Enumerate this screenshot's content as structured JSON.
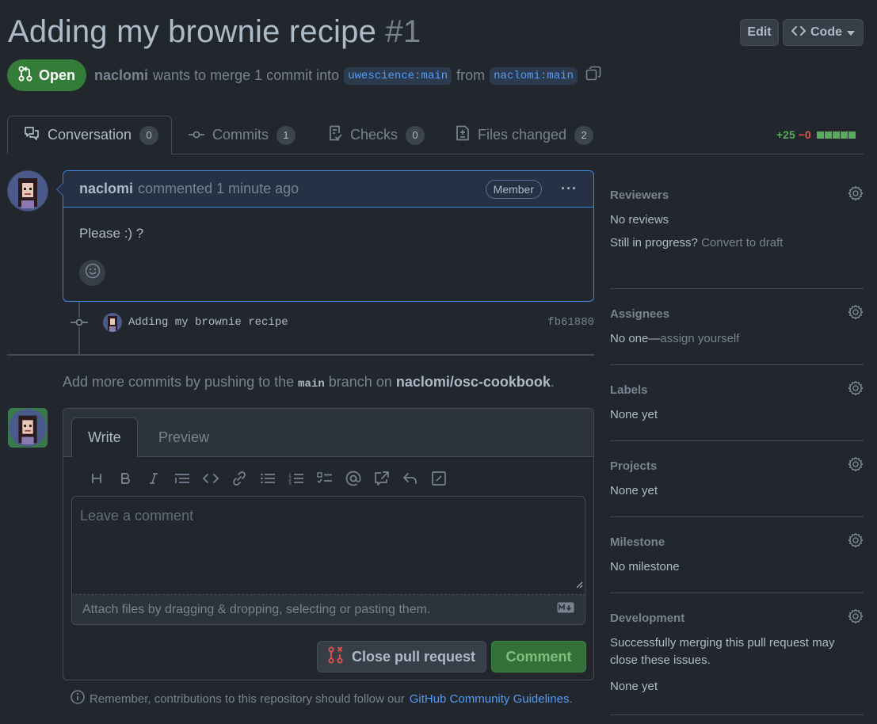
{
  "header": {
    "title": "Adding my brownie recipe",
    "number": "#1",
    "edit_label": "Edit",
    "code_label": "Code"
  },
  "state": {
    "label": "Open",
    "color": "#347d39"
  },
  "meta": {
    "author": "naclomi",
    "text_pre": "wants to merge 1 commit into",
    "base_branch": "uwescience:main",
    "from_text": "from",
    "head_branch": "naclomi:main"
  },
  "tabs": [
    {
      "label": "Conversation",
      "count": "0",
      "icon": "comment-discussion-icon"
    },
    {
      "label": "Commits",
      "count": "1",
      "icon": "git-commit-icon"
    },
    {
      "label": "Checks",
      "count": "0",
      "icon": "checklist-icon"
    },
    {
      "label": "Files changed",
      "count": "2",
      "icon": "file-diff-icon"
    }
  ],
  "diffstat": {
    "additions": "+25",
    "deletions": "−0"
  },
  "comment": {
    "author": "naclomi",
    "action": "commented 1 minute ago",
    "badge": "Member",
    "body": "Please :) ?"
  },
  "commit": {
    "message": "Adding my brownie recipe",
    "sha": "fb61880"
  },
  "push_note": {
    "pre": "Add more commits by pushing to the",
    "branch": "main",
    "mid": "branch on",
    "repo": "naclomi/osc-cookbook",
    "post": "."
  },
  "form": {
    "write_tab": "Write",
    "preview_tab": "Preview",
    "placeholder": "Leave a comment",
    "attach_text": "Attach files by dragging & dropping, selecting or pasting them.",
    "close_label": "Close pull request",
    "comment_label": "Comment"
  },
  "guidelines": {
    "pre": "Remember, contributions to this repository should follow our",
    "link": "GitHub Community Guidelines",
    "post": "."
  },
  "sidebar": {
    "reviewers": {
      "title": "Reviewers",
      "value": "No reviews",
      "draft_pre": "Still in progress?",
      "draft_link": "Convert to draft"
    },
    "assignees": {
      "title": "Assignees",
      "value": "No one—",
      "assign_link": "assign yourself"
    },
    "labels": {
      "title": "Labels",
      "value": "None yet"
    },
    "projects": {
      "title": "Projects",
      "value": "None yet"
    },
    "milestone": {
      "title": "Milestone",
      "value": "No milestone"
    },
    "development": {
      "title": "Development",
      "text": "Successfully merging this pull request may close these issues.",
      "value": "None yet"
    }
  }
}
